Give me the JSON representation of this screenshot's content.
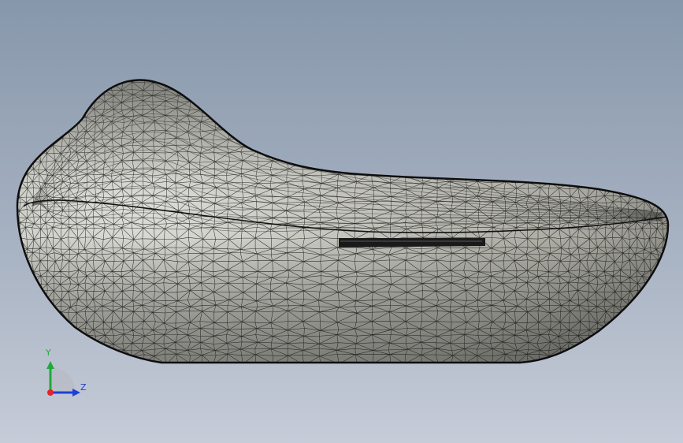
{
  "viewport": {
    "background_top": "#8797ab",
    "background_bottom": "#c6ccd8"
  },
  "model": {
    "display_style": "shaded-with-mesh-edges",
    "surface_color": "#d8d8d2",
    "mesh_line_color": "#111111",
    "slot_color": "#1a1a1a"
  },
  "triad": {
    "y_label": "Y",
    "z_label": "Z",
    "y_color": "#1faa3a",
    "z_color": "#1e3fd8",
    "x_color": "#e0252b"
  }
}
